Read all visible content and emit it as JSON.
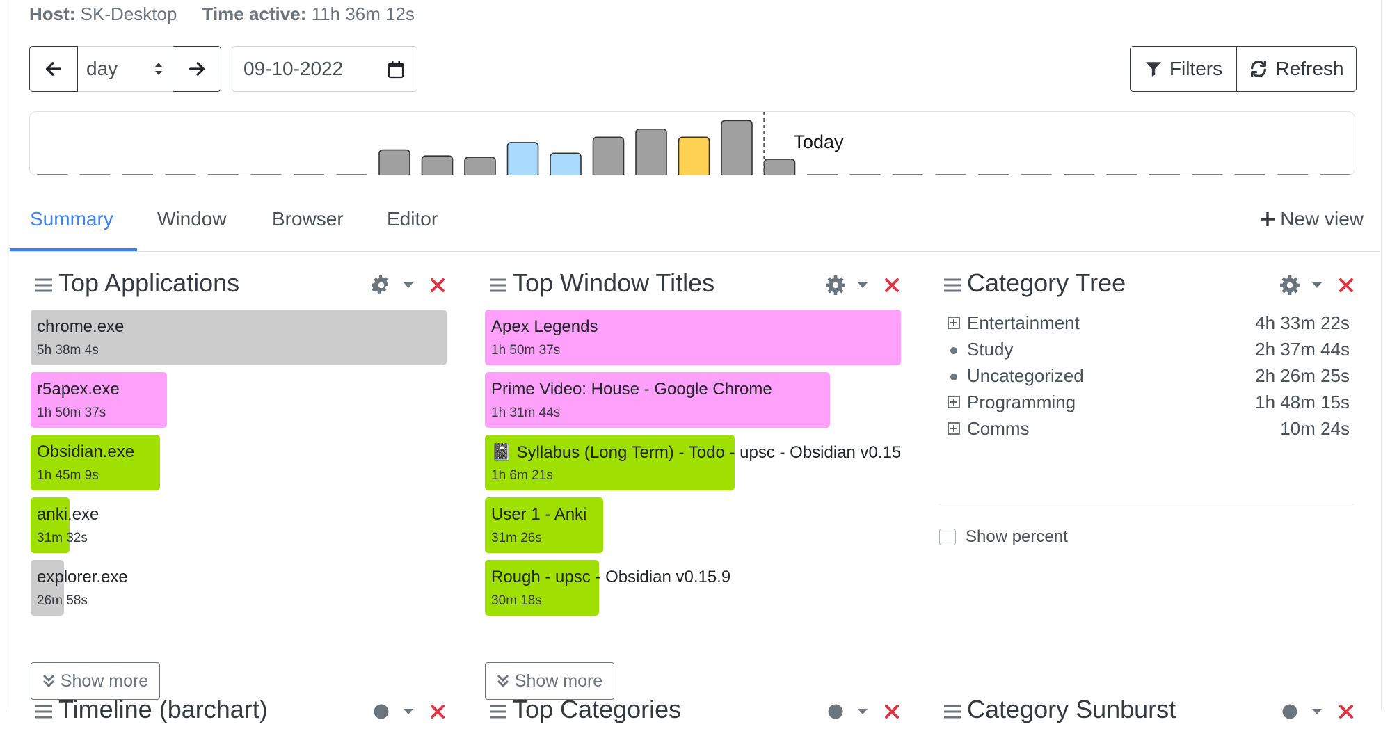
{
  "host": {
    "host_label": "Host:",
    "host_value": "SK-Desktop",
    "active_label": "Time active:",
    "active_value": "11h 36m 12s"
  },
  "nav": {
    "period": "day",
    "date": "09-10-2022"
  },
  "toolbar": {
    "filters_label": "Filters",
    "refresh_label": "Refresh"
  },
  "timeline": {
    "today_label": "Today",
    "chart_data": {
      "type": "bar",
      "days": 31,
      "values": [
        0,
        0,
        0,
        0,
        0,
        0,
        0,
        0,
        0.38,
        0.29,
        0.27,
        0.49,
        0.33,
        0.57,
        0.69,
        0.57,
        0.82,
        0.24,
        0,
        0,
        0,
        0,
        0,
        0,
        0,
        0,
        0,
        0,
        0,
        0,
        0
      ],
      "colors": [
        "#a0a0a0",
        "#a0a0a0",
        "#a0a0a0",
        "#a0a0a0",
        "#a0a0a0",
        "#a0a0a0",
        "#a0a0a0",
        "#a0a0a0",
        "#a0a0a0",
        "#a0a0a0",
        "#a0a0a0",
        "#aadbff",
        "#aadbff",
        "#a0a0a0",
        "#a0a0a0",
        "#ffd153",
        "#a0a0a0",
        "#a0a0a0",
        "#a0a0a0",
        "#a0a0a0",
        "#a0a0a0",
        "#a0a0a0",
        "#a0a0a0",
        "#a0a0a0",
        "#a0a0a0",
        "#a0a0a0",
        "#a0a0a0",
        "#a0a0a0",
        "#a0a0a0",
        "#a0a0a0",
        "#a0a0a0"
      ],
      "today_index": 17
    }
  },
  "tabs": [
    {
      "label": "Summary",
      "active": true
    },
    {
      "label": "Window",
      "active": false
    },
    {
      "label": "Browser",
      "active": false
    },
    {
      "label": "Editor",
      "active": false
    }
  ],
  "new_view_label": "New view",
  "panels": {
    "top_applications": {
      "title": "Top Applications",
      "items": [
        {
          "name": "chrome.exe",
          "time": "5h 38m 4s",
          "fraction": 1.0,
          "color": "#cccccc"
        },
        {
          "name": "r5apex.exe",
          "time": "1h 50m 37s",
          "fraction": 0.327,
          "color": "#ffa0fa"
        },
        {
          "name": "Obsidian.exe",
          "time": "1h 45m 9s",
          "fraction": 0.311,
          "color": "#a0e000"
        },
        {
          "name": "anki.exe",
          "time": "31m 32s",
          "fraction": 0.093,
          "color": "#a0e000"
        },
        {
          "name": "explorer.exe",
          "time": "26m 58s",
          "fraction": 0.08,
          "color": "#cccccc"
        }
      ],
      "show_more": "Show more"
    },
    "top_window_titles": {
      "title": "Top Window Titles",
      "items": [
        {
          "name": "Apex Legends",
          "time": "1h 50m 37s",
          "fraction": 1.0,
          "color": "#ffa0fa"
        },
        {
          "name": "Prime Video: House - Google Chrome",
          "time": "1h 31m 44s",
          "fraction": 0.83,
          "color": "#ffa0fa"
        },
        {
          "name": "📓 Syllabus (Long Term) - Todo - upsc - Obsidian v0.15.9",
          "time": "1h 6m 21s",
          "fraction": 0.6,
          "color": "#a0e000"
        },
        {
          "name": "User 1 - Anki",
          "time": "31m 26s",
          "fraction": 0.284,
          "color": "#a0e000"
        },
        {
          "name": "Rough - upsc - Obsidian v0.15.9",
          "time": "30m 18s",
          "fraction": 0.274,
          "color": "#a0e000"
        }
      ],
      "show_more": "Show more"
    },
    "category_tree": {
      "title": "Category Tree",
      "items": [
        {
          "name": "Entertainment",
          "time": "4h 33m 22s",
          "expandable": true
        },
        {
          "name": "Study",
          "time": "2h 37m 44s",
          "expandable": false
        },
        {
          "name": "Uncategorized",
          "time": "2h 26m 25s",
          "expandable": false
        },
        {
          "name": "Programming",
          "time": "1h 48m 15s",
          "expandable": true
        },
        {
          "name": "Comms",
          "time": "10m 24s",
          "expandable": true
        }
      ],
      "show_percent": "Show percent"
    },
    "bottom_titles": [
      "Timeline (barchart)",
      "Top Categories",
      "Category Sunburst"
    ]
  }
}
